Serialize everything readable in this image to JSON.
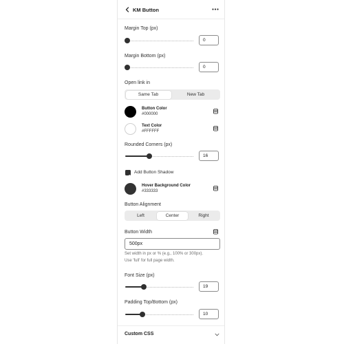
{
  "header": {
    "title": "KM Button",
    "back_icon": "chevron-left-icon",
    "more_icon": "more-horizontal-icon"
  },
  "margin_top": {
    "label": "Margin Top (px)",
    "value": "0",
    "level": 0
  },
  "margin_bottom": {
    "label": "Margin Bottom (px)",
    "value": "0",
    "level": 0
  },
  "open_link": {
    "label": "Open link in",
    "options": [
      "Same Tab",
      "New Tab"
    ],
    "selected": "Same Tab"
  },
  "button_color": {
    "name": "Button Color",
    "hex": "#000000"
  },
  "text_color": {
    "name": "Text Color",
    "hex": "#FFFFFF"
  },
  "rounded_corners": {
    "label": "Rounded Corners (px)",
    "value": "16",
    "level": 0.32
  },
  "shadow": {
    "label": "Add Button Shadow",
    "checked": true
  },
  "hover_color": {
    "name": "Hover Background Color",
    "hex": "#333333"
  },
  "alignment": {
    "label": "Button Alignment",
    "options": [
      "Left",
      "Center",
      "Right"
    ],
    "selected": "Center"
  },
  "button_width": {
    "label": "Button Width",
    "value": "500px",
    "help_line1": "Set width in px or % (e.g., 100% or 300px).",
    "help_line2": "Use 'full' for full page width."
  },
  "font_size": {
    "label": "Font Size (px)",
    "value": "19",
    "level": 0.24
  },
  "padding": {
    "label": "Padding Top/Bottom (px)",
    "value": "10",
    "level": 0.22
  },
  "custom_css": {
    "label": "Custom CSS",
    "expand_icon": "chevron-down-icon"
  },
  "colors": {
    "accent": "#303030",
    "border": "#8a8a8a",
    "segment_bg": "#ebebeb"
  }
}
